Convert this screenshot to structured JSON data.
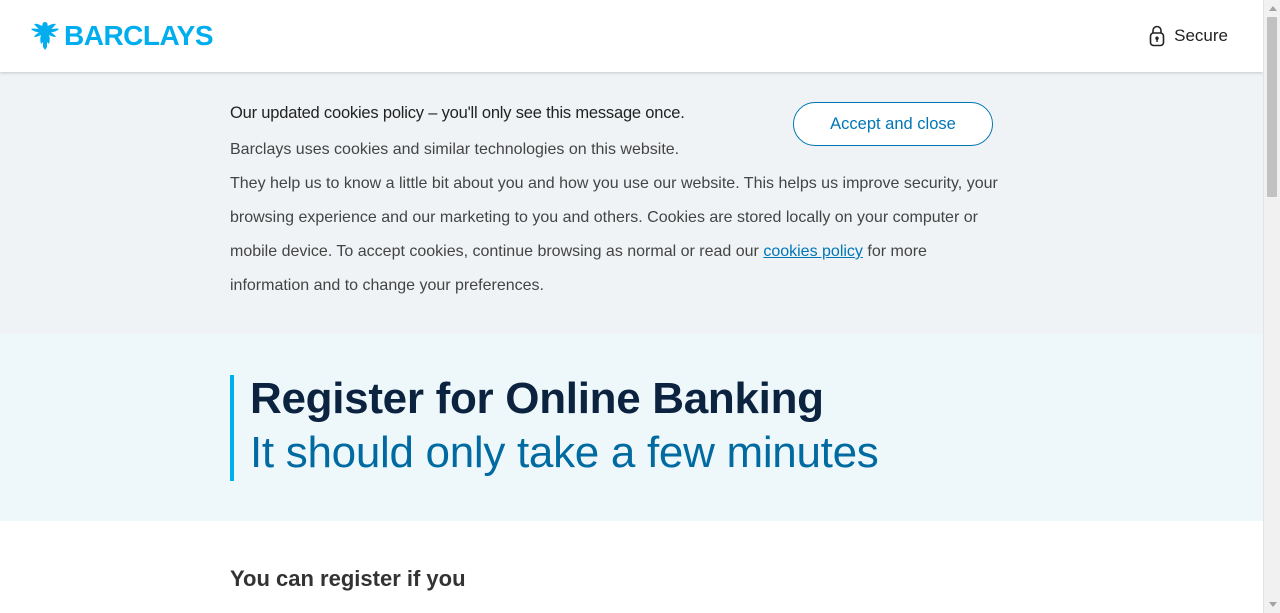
{
  "header": {
    "logo_text": "BARCLAYS",
    "logo_icon": "eagle-icon",
    "secure_label": "Secure",
    "secure_icon": "lock-icon"
  },
  "cookie_banner": {
    "title": "Our updated cookies policy – you'll only see this message once.",
    "line1": "Barclays uses cookies and similar technologies on this website.",
    "body_before_link": "They help us to know a little bit about you and how you use our website. This helps us improve security, your browsing experience and our marketing to you and others. Cookies are stored locally on your computer or mobile device. To accept cookies, continue browsing as normal or read our ",
    "link_text": "cookies policy",
    "body_after_link": " for more information and to change your preferences.",
    "accept_button": "Accept and close"
  },
  "hero": {
    "title": "Register for Online Banking",
    "subtitle": "It should only take a few minutes"
  },
  "content": {
    "register_heading": "You can register if you"
  },
  "colors": {
    "brand_blue": "#00aeef",
    "link_blue": "#0076b6",
    "navy": "#0c2340",
    "subtitle_blue": "#006aa1",
    "cookie_bg": "#f0f3f5",
    "hero_bg": "#eef8fb"
  }
}
